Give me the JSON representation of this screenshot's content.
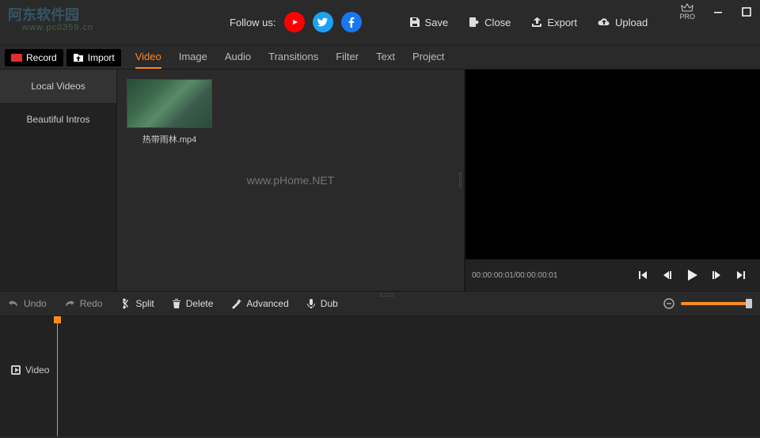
{
  "header": {
    "watermark_title": "阿东软件园",
    "watermark_url": "www.pc0359.cn",
    "follow_label": "Follow us:",
    "actions": {
      "save": "Save",
      "close": "Close",
      "export": "Export",
      "upload": "Upload"
    },
    "pro_label": "PRO"
  },
  "toolbar": {
    "record": "Record",
    "import": "Import",
    "tabs": {
      "video": "Video",
      "image": "Image",
      "audio": "Audio",
      "transitions": "Transitions",
      "filter": "Filter",
      "text": "Text",
      "project": "Project"
    }
  },
  "sidebar": {
    "local_videos": "Local Videos",
    "beautiful_intros": "Beautiful Intros"
  },
  "media": {
    "clip1_name": "热带雨林.mp4",
    "center_watermark": "www.pHome.NET"
  },
  "preview": {
    "timecode": "00:00:00:01/00:00:00:01"
  },
  "timeline_toolbar": {
    "undo": "Undo",
    "redo": "Redo",
    "split": "Split",
    "delete": "Delete",
    "advanced": "Advanced",
    "dub": "Dub"
  },
  "timeline": {
    "track_video": "Video"
  }
}
